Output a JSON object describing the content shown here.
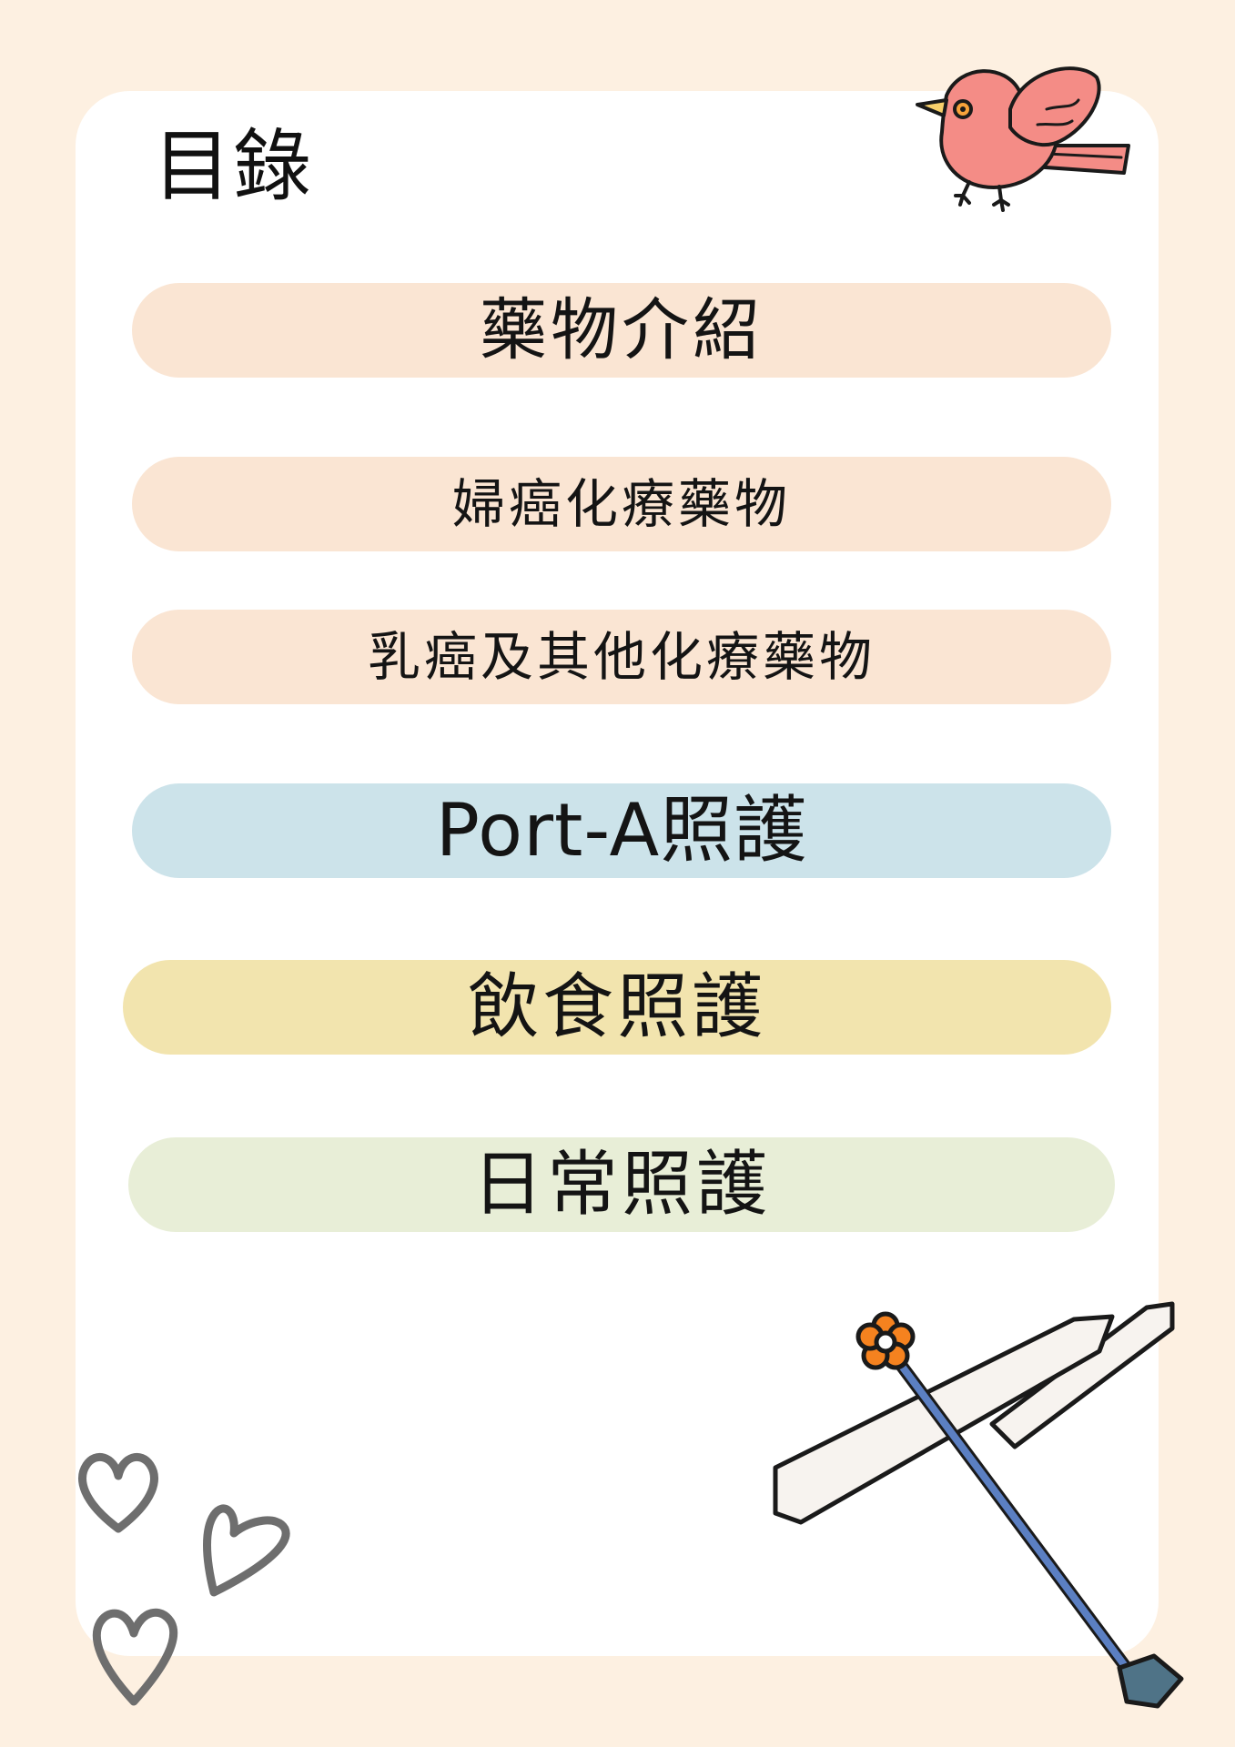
{
  "title": "目錄",
  "items": [
    {
      "label": "藥物介紹",
      "color": "#fae5d3"
    },
    {
      "label": "婦癌化療藥物",
      "color": "#fae5d3"
    },
    {
      "label": "乳癌及其他化療藥物",
      "color": "#fae5d3"
    },
    {
      "label": "Port-A照護",
      "color": "#cce3ea"
    },
    {
      "label": "飲食照護",
      "color": "#f2e4ae"
    },
    {
      "label": "日常照護",
      "color": "#e8eed7"
    }
  ],
  "colors": {
    "background": "#fdf0e1",
    "card": "#ffffff",
    "bird": "#f48c86",
    "heart": "#6e6e6e",
    "plane_body": "#5b7fc2",
    "plane_flower": "#f5821f"
  },
  "icons": [
    "bird-icon",
    "heart-icon",
    "airplane-icon"
  ]
}
